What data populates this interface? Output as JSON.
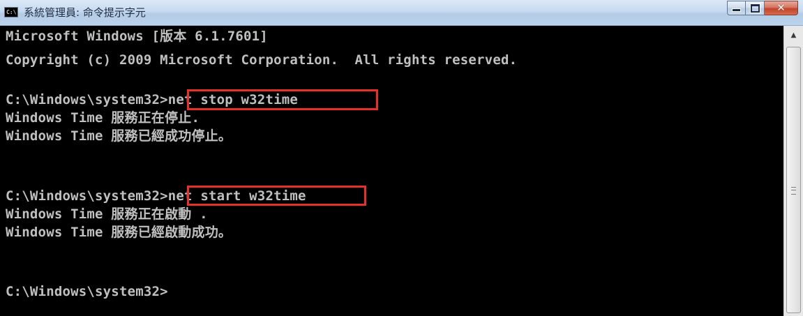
{
  "window": {
    "icon_text": "C:\\",
    "title": "系統管理員: 命令提示字元"
  },
  "console": {
    "lines": [
      "Microsoft Windows [版本 6.1.7601]",
      "Copyright (c) 2009 Microsoft Corporation.  All rights reserved.",
      "",
      "C:\\Windows\\system32>net stop w32time",
      "Windows Time 服務正在停止.",
      "Windows Time 服務已經成功停止。",
      "",
      "",
      "C:\\Windows\\system32>net start w32time",
      "Windows Time 服務正在啟動 .",
      "Windows Time 服務已經啟動成功。",
      "",
      "",
      "C:\\Windows\\system32>"
    ]
  },
  "highlight_color": "#e4312b",
  "icons": {
    "minimize": "minimize-icon",
    "maximize": "maximize-icon",
    "close": "close-icon",
    "scroll_up": "arrow-up-icon"
  }
}
